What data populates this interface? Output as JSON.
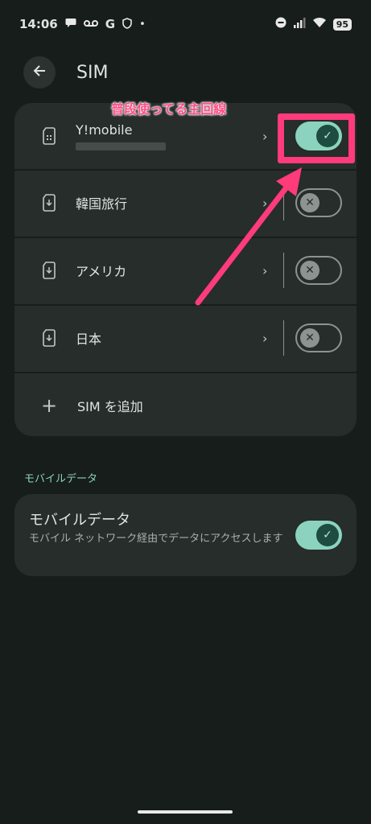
{
  "status_bar": {
    "time": "14:06",
    "icons_left": [
      "message-bubble-icon",
      "voicemail-icon",
      "google-g-icon",
      "shield-icon",
      "dot-icon"
    ],
    "icons_right": [
      "do-not-disturb-icon",
      "signal-icon",
      "wifi-icon"
    ],
    "battery_level": "95"
  },
  "header": {
    "title": "SIM",
    "back_icon": "arrow-back-icon"
  },
  "sims": [
    {
      "name": "Y!mobile",
      "subtitle_masked": true,
      "icon": "sim-card-icon",
      "enabled": true
    },
    {
      "name": "韓国旅行",
      "icon": "esim-download-icon",
      "enabled": false
    },
    {
      "name": "アメリカ",
      "icon": "esim-download-icon",
      "enabled": false
    },
    {
      "name": "日本",
      "icon": "esim-download-icon",
      "enabled": false
    }
  ],
  "add_sim": {
    "label": "SIM を追加",
    "icon": "plus-icon"
  },
  "mobile_data_section": {
    "header": "モバイルデータ",
    "title": "モバイルデータ",
    "summary": "モバイル ネットワーク経由でデータにアクセスします",
    "enabled": true
  },
  "annotation": {
    "label": "普段使ってる主回線",
    "color": "#ff3b7b"
  },
  "colors": {
    "background": "#171d1b",
    "card": "#262d2b",
    "accent": "#8bd3bd"
  }
}
